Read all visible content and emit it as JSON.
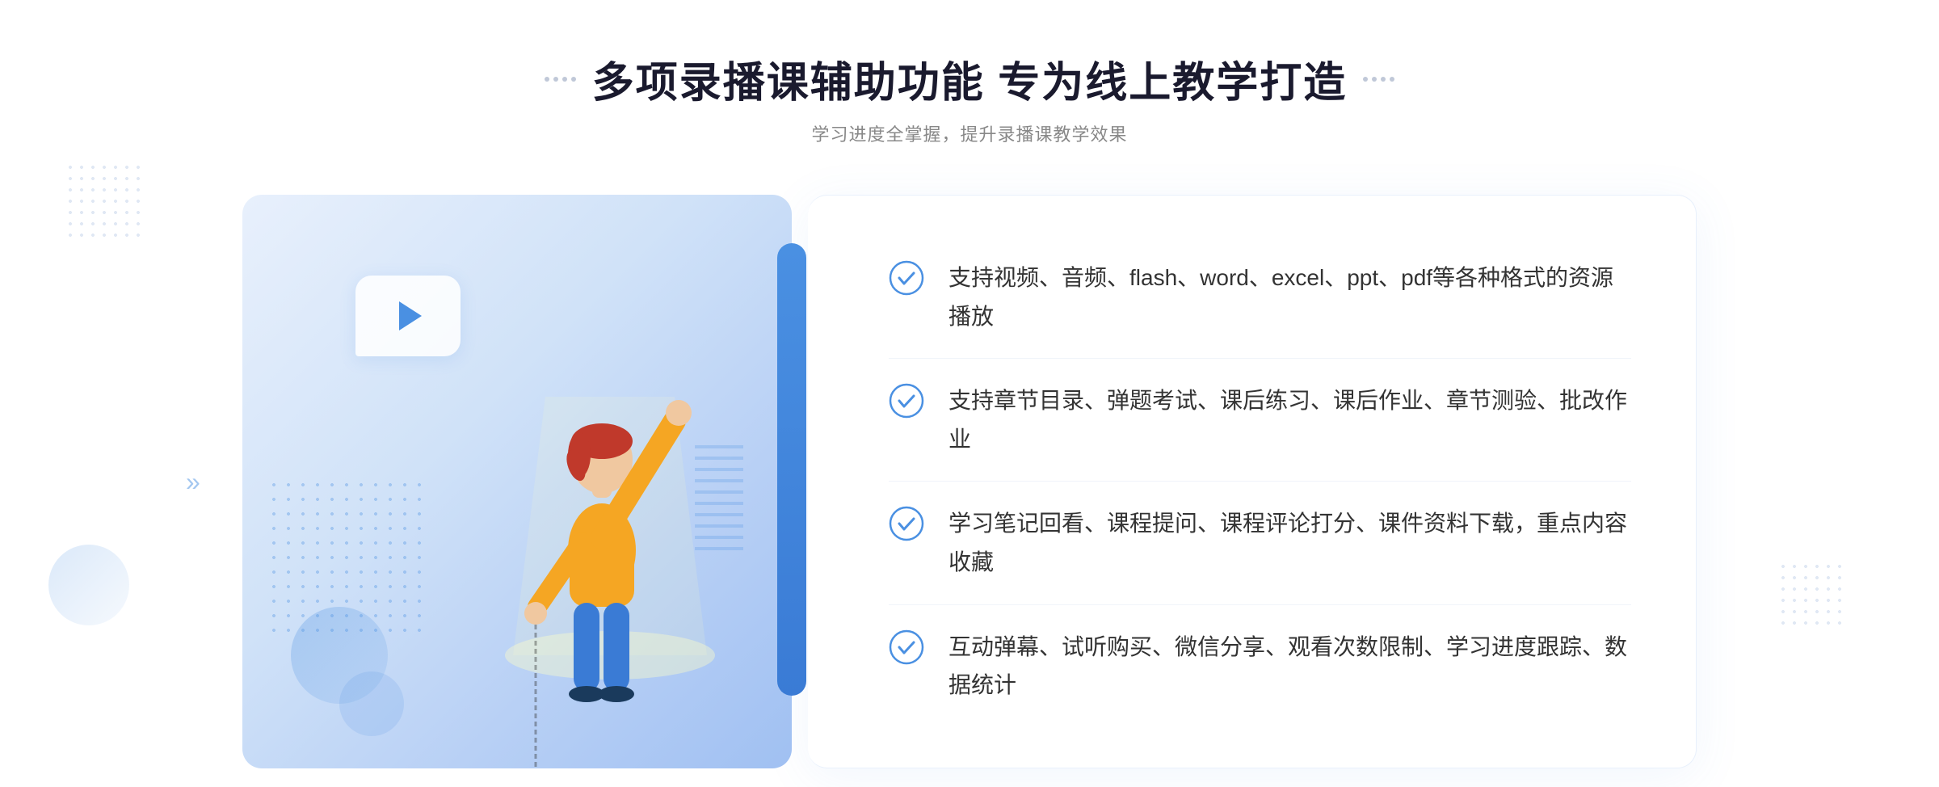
{
  "page": {
    "background": "#ffffff"
  },
  "header": {
    "title": "多项录播课辅助功能 专为线上教学打造",
    "subtitle": "学习进度全掌握，提升录播课教学效果"
  },
  "features": [
    {
      "id": 1,
      "text": "支持视频、音频、flash、word、excel、ppt、pdf等各种格式的资源播放"
    },
    {
      "id": 2,
      "text": "支持章节目录、弹题考试、课后练习、课后作业、章节测验、批改作业"
    },
    {
      "id": 3,
      "text": "学习笔记回看、课程提问、课程评论打分、课件资料下载，重点内容收藏"
    },
    {
      "id": 4,
      "text": "互动弹幕、试听购买、微信分享、观看次数限制、学习进度跟踪、数据统计"
    }
  ],
  "decorative": {
    "chevron_symbol": "»",
    "play_button_aria": "play-button"
  }
}
